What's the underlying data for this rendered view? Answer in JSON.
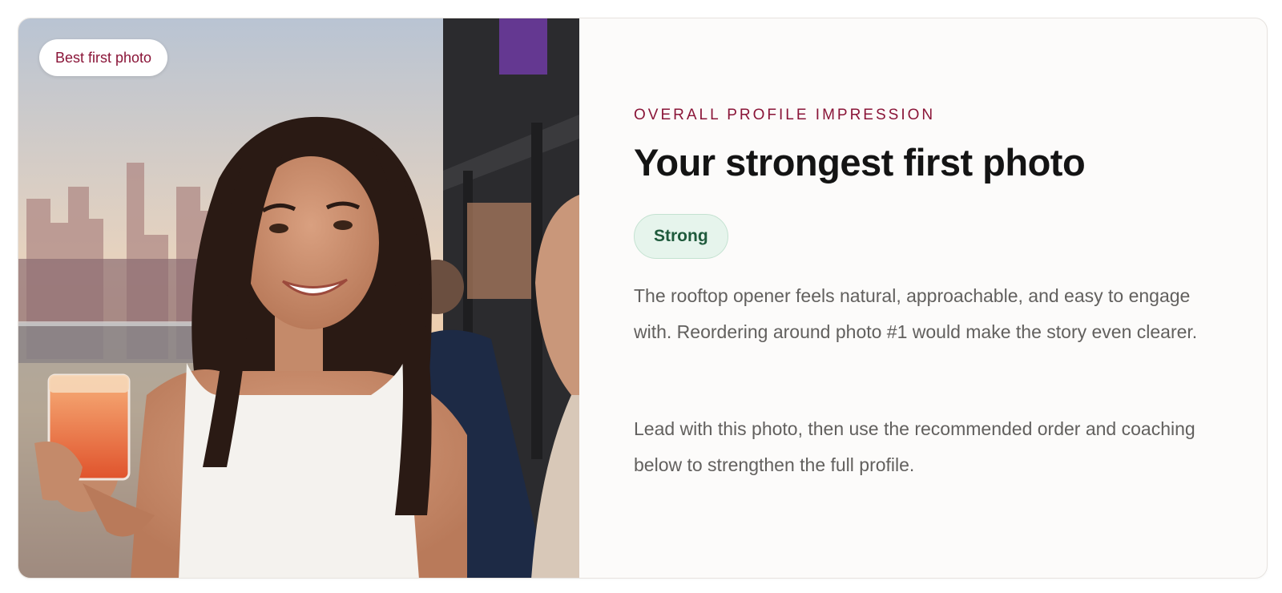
{
  "photo": {
    "badge_label": "Best first photo",
    "description_icon": "rooftop-photo"
  },
  "impression": {
    "eyebrow": "OVERALL PROFILE IMPRESSION",
    "title": "Your strongest first photo",
    "rating": "Strong",
    "summary": "The rooftop opener feels natural, approachable, and easy to engage with. Reordering around photo #1 would make the story even clearer.",
    "advice": "Lead with this photo, then use the recommended order and coaching below to strengthen the full profile."
  },
  "colors": {
    "accent": "#8a1538",
    "rating_bg": "#e6f4ec",
    "rating_text": "#1f5a3c",
    "title": "#141414",
    "body": "#62605e"
  }
}
